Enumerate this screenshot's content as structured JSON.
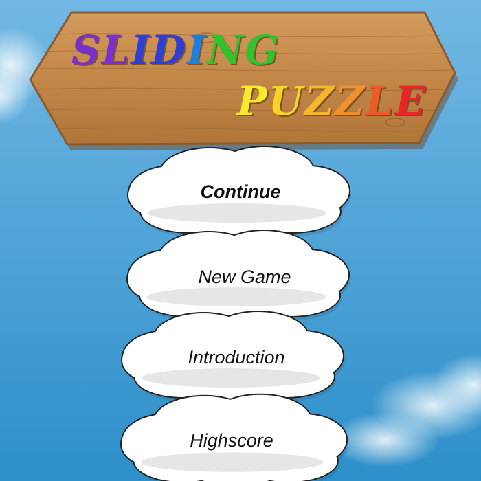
{
  "title": {
    "word1": "SLIDING",
    "word2": "PUZZLE",
    "word1_colors": [
      "#7a2fd0",
      "#7a2fd0",
      "#2e3fd6",
      "#2e3fd6",
      "#1a7fe0",
      "#34c22c",
      "#34c22c"
    ],
    "word2_colors": [
      "#f6ea2a",
      "#f6d22a",
      "#f6b72a",
      "#f2912a",
      "#ee5a2a",
      "#e8262a"
    ]
  },
  "menu": {
    "continue_label": "Continue",
    "new_game_label": "New Game",
    "introduction_label": "Introduction",
    "highscore_label": "Highscore"
  },
  "colors": {
    "sky_top": "#6fb6e4",
    "sky_bottom": "#2f92cc",
    "wood": "#c58a4e",
    "wood_dark": "#8a5a2e",
    "cloud": "#ffffff"
  }
}
